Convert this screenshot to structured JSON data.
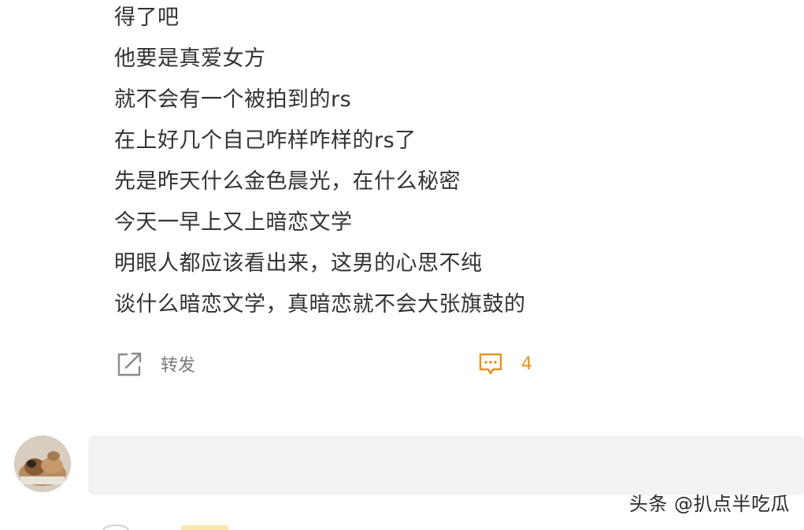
{
  "post": {
    "lines": [
      "得了吧",
      "他要是真爱女方",
      "就不会有一个被拍到的rs",
      "在上好几个自己咋样咋样的rs了",
      "先是昨天什么金色晨光，在什么秘密",
      "今天一早上又上暗恋文学",
      "明眼人都应该看出来，这男的心思不纯",
      "谈什么暗恋文学，真暗恋就不会大张旗鼓的"
    ]
  },
  "actions": {
    "repost_icon": "share-icon",
    "repost_label": "转发",
    "comment_icon": "comment-icon",
    "comment_count": "4"
  },
  "comment_box": {
    "avatar_icon": "avatar-photo"
  },
  "watermark": {
    "text": "头条 @扒点半吃瓜"
  },
  "colors": {
    "accent": "#e0931f",
    "text": "#333333",
    "muted": "#7a7a7a",
    "input_bg": "#f3f3f3"
  }
}
